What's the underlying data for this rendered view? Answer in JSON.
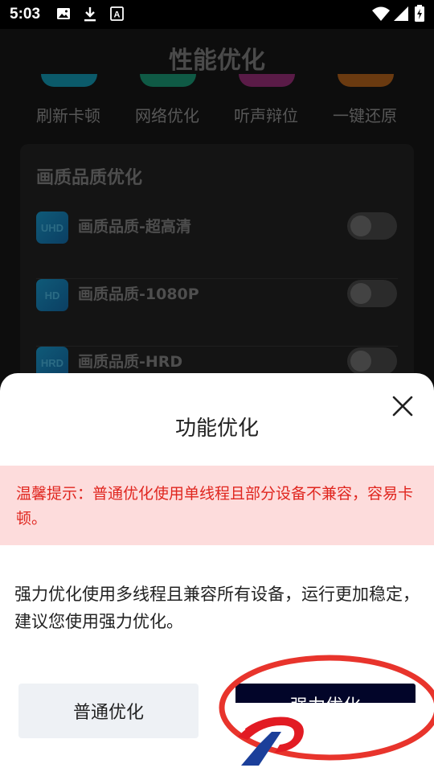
{
  "status_bar": {
    "time": "5:03",
    "left_icons": [
      "image-icon",
      "download-icon",
      "font-icon"
    ],
    "right_icons": [
      "wifi-icon",
      "signal-icon",
      "battery-charging-icon"
    ]
  },
  "background": {
    "title": "性能优化",
    "quick_items": [
      {
        "label": "刷新卡顿",
        "color": "#0b5a6a"
      },
      {
        "label": "网络优化",
        "color": "#0f5a45"
      },
      {
        "label": "听声辩位",
        "color": "#5a1b47"
      },
      {
        "label": "一键还原",
        "color": "#6a3a10"
      }
    ],
    "quality_card": {
      "title": "画质品质优化",
      "rows": [
        {
          "badge": "UHD",
          "label": "画质品质-超高清",
          "enabled": false
        },
        {
          "badge": "HD",
          "label": "画质品质-1080P",
          "enabled": false
        },
        {
          "badge": "HRD",
          "label": "画质品质-HRD",
          "enabled": false
        }
      ]
    }
  },
  "sheet": {
    "title": "功能优化",
    "warning": "温馨提示：普通优化使用单线程且部分设备不兼容，容易卡顿。",
    "description": "强力优化使用多线程且兼容所有设备，运行更加稳定，建议您使用强力优化。",
    "normal_button": "普通优化",
    "strong_button": "强力优化",
    "accent_red": "#e0261f",
    "strong_button_color": "#020529"
  }
}
